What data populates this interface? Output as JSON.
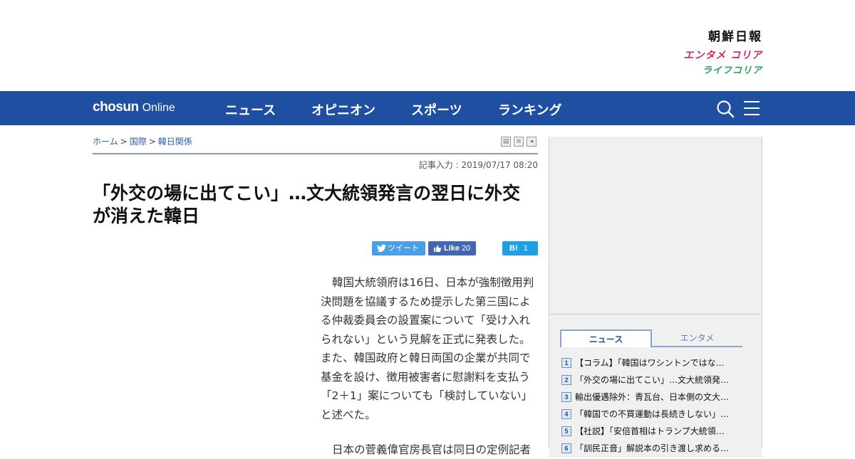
{
  "brand": {
    "chosun": "朝鮮日報",
    "entame": "エンタメ コリア",
    "life": "ライフコリア"
  },
  "nav": {
    "logo_bold": "chosun",
    "logo_light": "Online",
    "items": [
      {
        "label": "ニュース"
      },
      {
        "label": "オピニオン"
      },
      {
        "label": "スポーツ"
      },
      {
        "label": "ランキング"
      }
    ]
  },
  "breadcrumb": {
    "home": "ホーム",
    "section": "国際",
    "subsection": "韓日関係",
    "separator": ">"
  },
  "article": {
    "date": "記事入力 : 2019/07/17 08:20",
    "headline": "「外交の場に出てこい」…文大統領発言の翌日に外交が消えた韓日",
    "body_p1": "韓国大統領府は16日、日本が強制徴用判決問題を協議するため提示した第三国による仲裁委員会の設置案について「受け入れられない」という見解を正式に発表した。また、韓国政府と韓日両国の企業が共同で基金を設け、徴用被害者に慰謝料を支払う「2＋1」案についても「検討していない」と述べた。",
    "body_p2": "日本の菅義偉官房長官は同日の定例記者"
  },
  "share": {
    "tweet": "ツイート",
    "like": "Like",
    "like_count": "20",
    "hatena": "B!",
    "hatena_count": "1"
  },
  "sidebar": {
    "tabs": [
      {
        "label": "ニュース",
        "active": true
      },
      {
        "label": "エンタメ",
        "active": false
      }
    ],
    "ranking": [
      {
        "num": "1",
        "title": "【コラム】「韓国はワシントンではな…"
      },
      {
        "num": "2",
        "title": "「外交の場に出てこい」…文大統領発…"
      },
      {
        "num": "3",
        "title": "輸出優遇除外：青瓦台、日本側の文大…"
      },
      {
        "num": "4",
        "title": "「韓国での不買運動は長続きしない」…"
      },
      {
        "num": "5",
        "title": "【社説】「安倍首相はトランプ大統領…"
      },
      {
        "num": "6",
        "title": "「訓民正音」解説本の引き渡し求める…"
      }
    ]
  },
  "colors": {
    "nav_bg": "#1f4fa0",
    "entame": "#d4245a",
    "life": "#2aa05a",
    "twitter": "#4aa0e6",
    "facebook": "#4267b2",
    "hatena": "#1ea0e6"
  }
}
